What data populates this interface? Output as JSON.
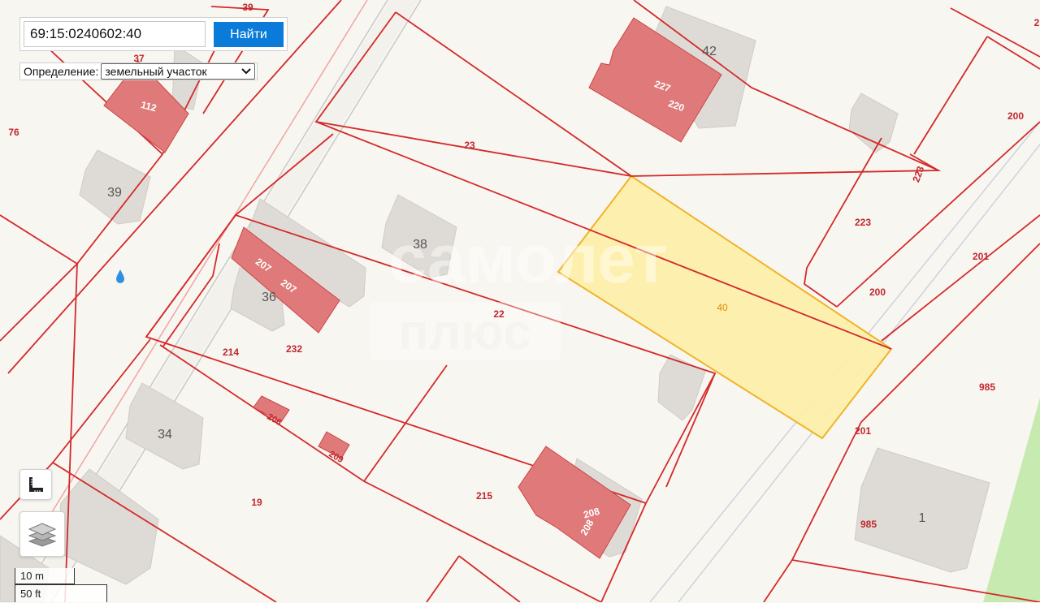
{
  "search": {
    "value": "69:15:0240602:40",
    "button_label": "Найти"
  },
  "definition": {
    "label": "Определение:",
    "selected": "земельный участок"
  },
  "map": {
    "selected_parcel": "40",
    "parcel_labels": [
      "23",
      "22",
      "19",
      "215",
      "214",
      "232",
      "223",
      "223",
      "200",
      "200",
      "201",
      "201",
      "985",
      "985",
      "76",
      "37",
      "39"
    ],
    "building_labels": [
      "112",
      "227",
      "220",
      "207",
      "207",
      "206",
      "209",
      "208",
      "208"
    ],
    "house_numbers": [
      "42",
      "39",
      "38",
      "36",
      "34",
      "1"
    ],
    "watermark": [
      "самолет",
      "плюс"
    ],
    "edge_numbers": [
      "2"
    ]
  },
  "scale": {
    "meters": "10 m",
    "feet": "50 ft"
  },
  "colors": {
    "background": "#f8f6f1",
    "parcel_line": "#d32a2a",
    "building": "#e07a7a",
    "selected_fill": "#fdf0a6",
    "selected_stroke": "#f0b429",
    "button": "#0a7bd8",
    "house_block": "#dedbd6",
    "park": "#c7eab0"
  },
  "icons": {
    "ruler": "ruler-icon",
    "layers": "layers-icon",
    "water": "water-drop-icon"
  }
}
